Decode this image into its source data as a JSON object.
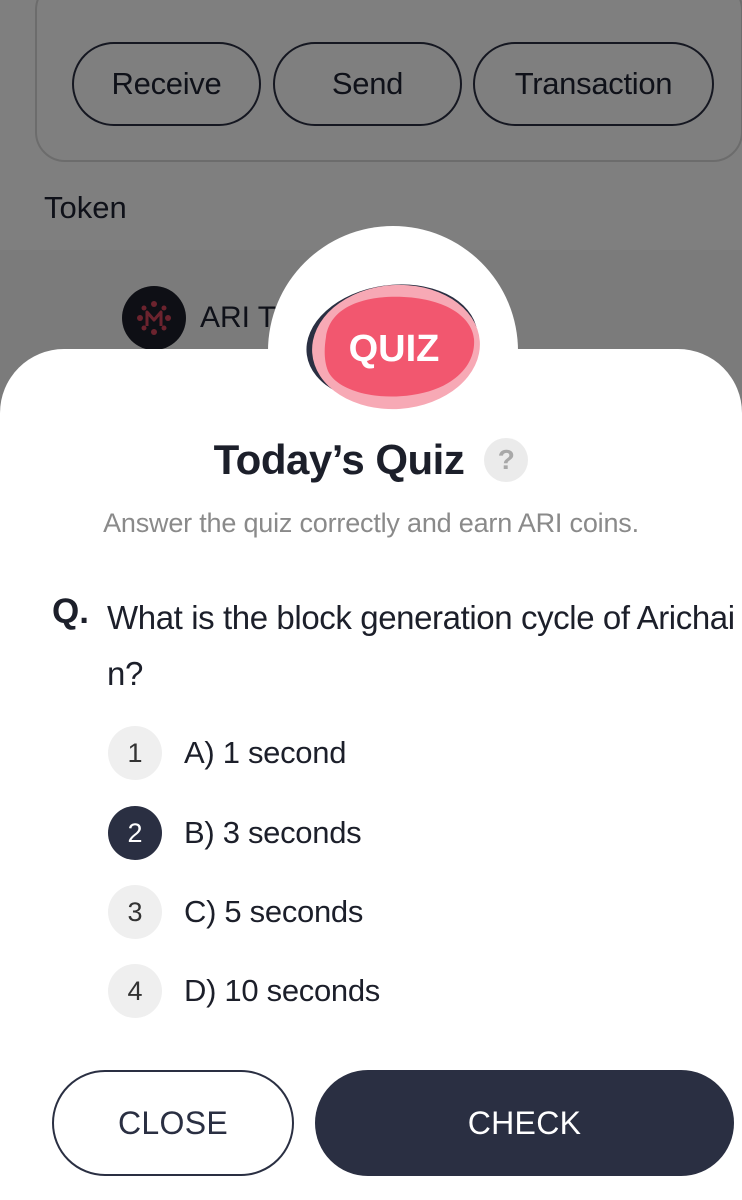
{
  "wallet": {
    "actions": [
      "Receive",
      "Send",
      "Transaction"
    ],
    "token_heading": "Token",
    "token_name": "ARI T"
  },
  "quiz": {
    "badge_text": "QUIZ",
    "title": "Today’s Quiz",
    "help_icon": "?",
    "subtitle": "Answer the quiz correctly and earn ARI coins.",
    "question_prefix": "Q.",
    "question": "What is the block generation cycle of Arichain?",
    "options": [
      {
        "number": "1",
        "label": "A) 1 second",
        "selected": false
      },
      {
        "number": "2",
        "label": "B) 3 seconds",
        "selected": true
      },
      {
        "number": "3",
        "label": "C) 5 seconds",
        "selected": false
      },
      {
        "number": "4",
        "label": "D) 10 seconds",
        "selected": false
      }
    ],
    "close_label": "CLOSE",
    "check_label": "CHECK"
  },
  "colors": {
    "primary": "#2a2f42",
    "badge_red": "#f2576f",
    "badge_pink": "#f7a9b5",
    "badge_dark": "#2a2f42"
  }
}
